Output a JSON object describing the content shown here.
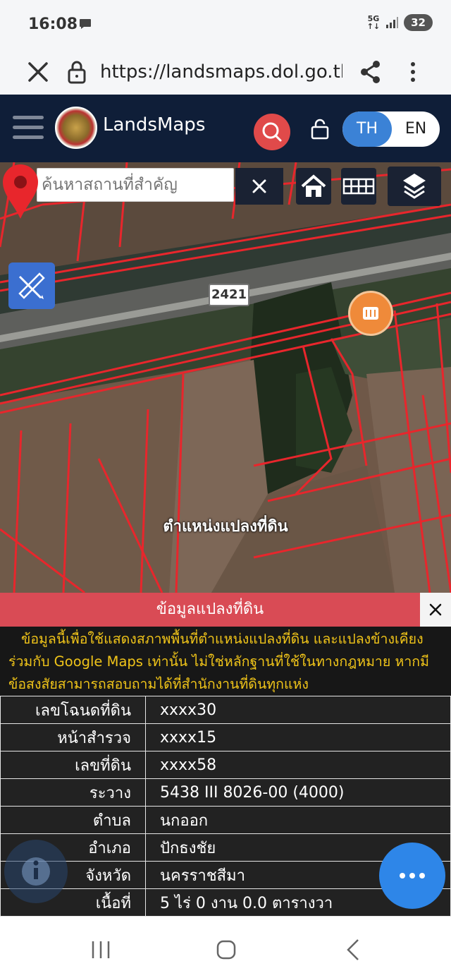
{
  "status_bar": {
    "time": "16:08",
    "network": "5G",
    "battery": "32"
  },
  "browser": {
    "url": "https://landsmaps.dol.go.th/#"
  },
  "header": {
    "app_name": "LandsMaps",
    "lang_th": "TH",
    "lang_en": "EN"
  },
  "map": {
    "search_placeholder": "ค้นหาสถานที่สำคัญ",
    "road_number": "2421",
    "pin_label": "ตำแหน่งแปลงที่ดิน"
  },
  "panel": {
    "title": "ข้อมูลแปลงที่ดิน",
    "notice_lines": [
      "ข้อมูลนี้เพื่อใช้แสดงสภาพพื้นที่ตำแหน่งแปลงที่ดิน และแปลงข้างเคียง",
      "ร่วมกับ Google Maps เท่านั้น ไม่ใช่หลักฐานที่ใช้ในทางกฎหมาย หากมี",
      "ข้อสงสัยสามารถสอบถามได้ที่สำนักงานที่ดินทุกแห่ง"
    ],
    "rows": [
      {
        "label": "เลขโฉนดที่ดิน",
        "value": "xxxx30"
      },
      {
        "label": "หน้าสำรวจ",
        "value": "xxxx15"
      },
      {
        "label": "เลขที่ดิน",
        "value": "xxxx58"
      },
      {
        "label": "ระวาง",
        "value": "5438 III 8026-00 (4000)"
      },
      {
        "label": "ตำบล",
        "value": "นกออก"
      },
      {
        "label": "อำเภอ",
        "value": "ปักธงชัย"
      },
      {
        "label": "จังหวัด",
        "value": "นครราชสีมา"
      },
      {
        "label": "เนื้อที่",
        "value": "5 ไร่ 0 งาน 0.0 ตารางวา"
      }
    ]
  },
  "icons": {
    "message": "message-icon",
    "signal": "signal-icon",
    "close": "close-icon",
    "lock": "lock-icon",
    "share": "share-icon",
    "menu": "more-vertical-icon",
    "hamburger": "hamburger-icon",
    "search": "search-icon",
    "home": "home-icon",
    "grid": "grid-icon",
    "layers": "layers-icon",
    "measure": "ruler-pencil-icon",
    "poi": "restaurant-icon",
    "pin": "map-pin-icon",
    "info": "info-icon",
    "more": "more-horizontal-icon"
  },
  "colors": {
    "header_bg": "#0f1e38",
    "accent_blue": "#3b82d6",
    "panel_red": "#d94b55",
    "notice_text": "#f0c419",
    "parcel_line": "#e8262c"
  }
}
